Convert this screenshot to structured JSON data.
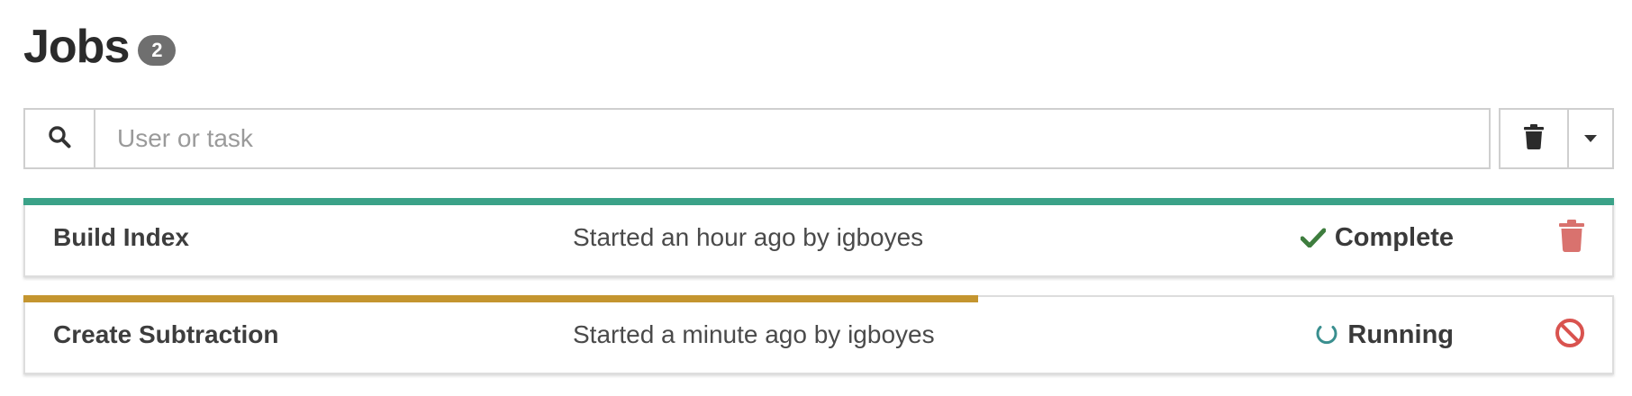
{
  "header": {
    "title": "Jobs",
    "count": "2"
  },
  "search": {
    "icon": "search-icon",
    "placeholder": "User or task",
    "value": ""
  },
  "toolbar": {
    "clear_icon": "trash-icon",
    "menu_icon": "caret-down-icon"
  },
  "colors": {
    "complete_bar": "#3ba288",
    "running_bar": "#c4952f",
    "complete_check": "#3e7d3e",
    "running_spinner": "#3a8f8f",
    "remove_icon": "#d9726e",
    "cancel_icon": "#d9534f"
  },
  "jobs": [
    {
      "name": "Build Index",
      "meta": "Started an hour ago by igboyes",
      "status": "Complete",
      "status_icon": "check-icon",
      "action_icon": "trash-icon",
      "progress": 1.0
    },
    {
      "name": "Create Subtraction",
      "meta": "Started a minute ago by igboyes",
      "status": "Running",
      "status_icon": "spinner-icon",
      "action_icon": "cancel-icon",
      "progress": 0.6
    }
  ]
}
